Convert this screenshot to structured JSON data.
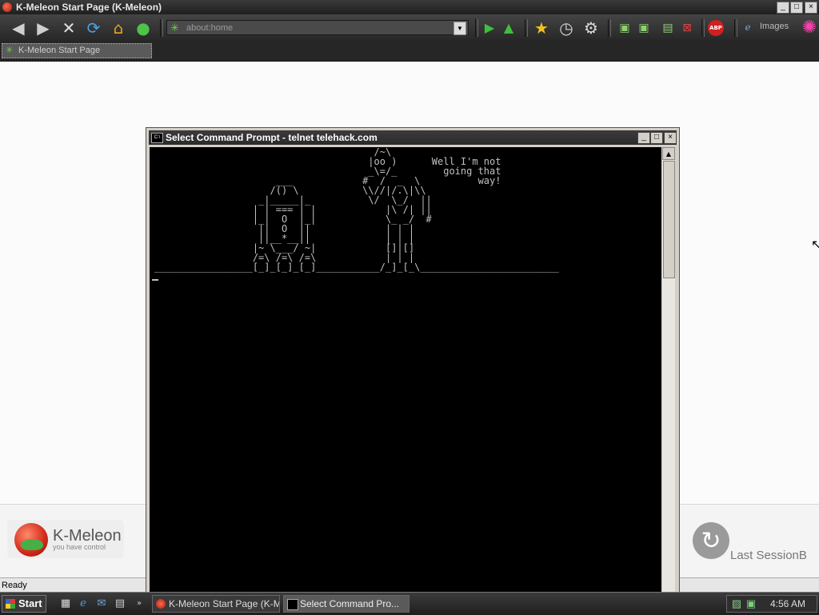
{
  "window": {
    "title": "K-Meleon Start Page (K-Meleon)"
  },
  "toolbar": {
    "address": "about:home",
    "images_label": "Images",
    "adblock_label": "ABP"
  },
  "tab": {
    "label": "K-Meleon Start Page"
  },
  "page": {
    "brand_name": "K-Meleon",
    "brand_tagline": "you have control",
    "session_label": "Last SessionB"
  },
  "status": {
    "text": "Ready"
  },
  "cmd_window": {
    "title": "Select Command Prompt - telnet telehack.com",
    "icon_text": "C:\\",
    "art": "                                      /~\\\n                                     |oo )      Well I'm not\n                                     _\\=/_        going that\n                     ___            #  /  _  \\          way!\n                    /() \\           \\\\//|/.\\|\\\\\n                  _|_____|_          \\/  \\_/  ||\n                 | | === | |            |\\ /| ||\n                 |_|  O  |_|            \\_ _/  #\n                  ||  O  ||             | | |\n                  ||__*__||             | | |\n                 |~ \\___/ ~|            []|[]\n                 /=\\ /=\\ /=\\            | | |\n_________________[_]_[_]_[_]___________/_]_[_\\________________________"
  },
  "taskbar": {
    "start_label": "Start",
    "tasks": [
      {
        "label": "K-Meleon Start Page (K-M..."
      },
      {
        "label": "Select Command Pro..."
      }
    ],
    "clock": "4:56 AM"
  },
  "colors": {
    "chrome_dark": "#262626",
    "console_bg": "#000000",
    "console_fg": "#c0c0c0",
    "accent_green": "#6dd34a"
  }
}
